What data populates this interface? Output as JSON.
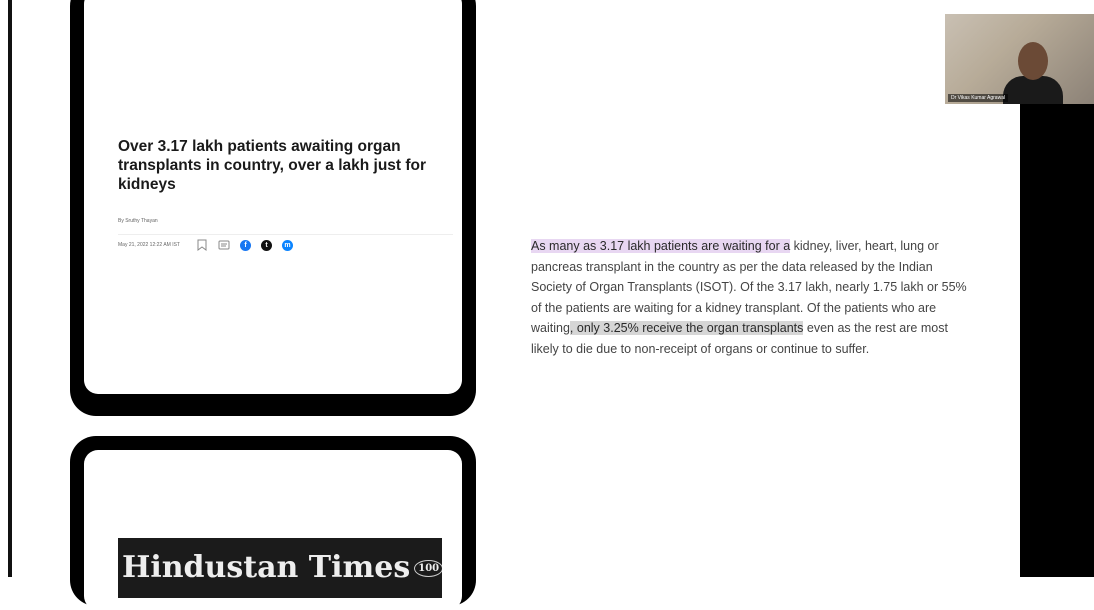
{
  "article_card": {
    "headline": "Over 3.17 lakh patients awaiting organ transplants in country, over a lakh just for kidneys",
    "byline": "By Sruthy Thayan",
    "date": "May 21, 2022 12:22 AM IST",
    "icons": [
      "bookmark-icon",
      "comment-icon",
      "facebook-icon",
      "twitter-icon",
      "messenger-icon"
    ]
  },
  "masthead": {
    "name": "Hindustan Times",
    "badge": "100"
  },
  "article_text": {
    "highlight1": "As many as 3.17 lakh patients are waiting for a",
    "part2": " kidney, liver, heart, lung or pancreas transplant in the country as per the data released by the Indian Society of Organ Transplants (ISOT). Of the 3.17 lakh, nearly 1.75 lakh or 55% of the patients are waiting for a kidney transplant. Of the patients who are waiting",
    "highlight2": ", only 3.25% receive the organ transplants",
    "part3": " even as the rest are most likely to die due to non-receipt of organs or continue to suffer."
  },
  "video": {
    "participant_name": "Dr Vikas Kumar Agrawal"
  },
  "colors": {
    "highlight_purple": "#e8d7f2",
    "highlight_grey": "#d6d6d6",
    "facebook": "#1877f2",
    "messenger": "#0b84ff"
  }
}
